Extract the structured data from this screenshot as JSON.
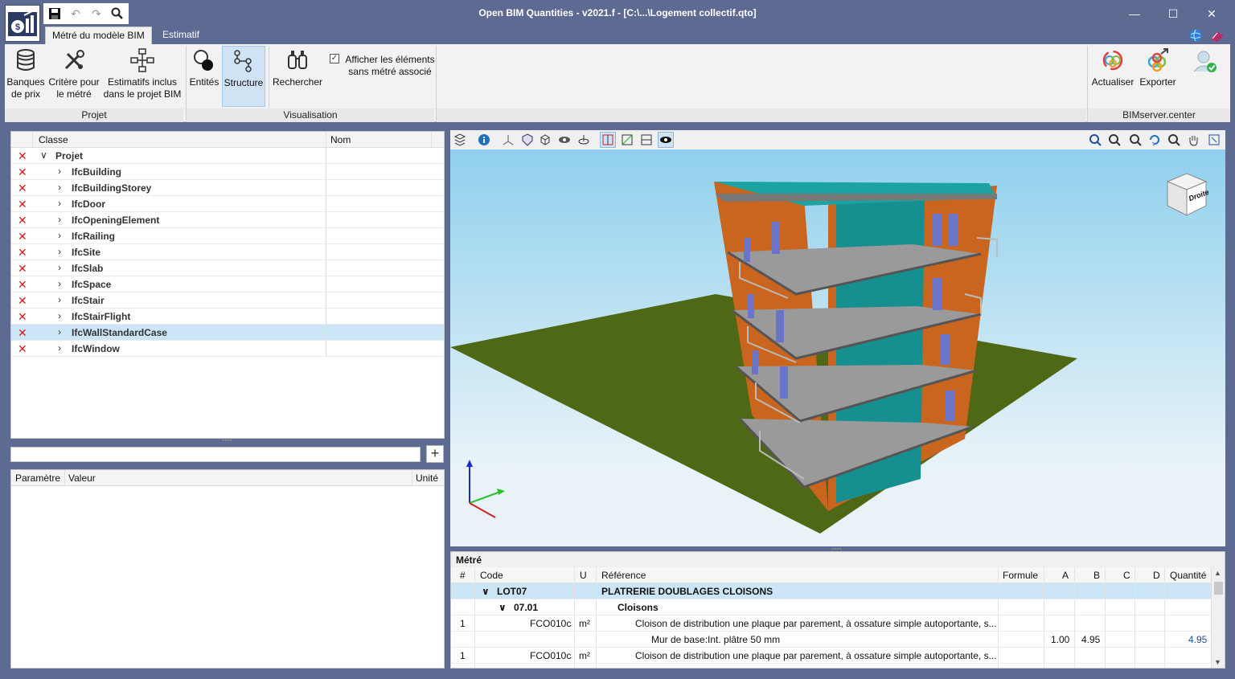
{
  "window": {
    "title": "Open BIM Quantities - v2021.f - [C:\\...\\Logement collectif.qto]",
    "minimize": "—",
    "maximize": "☐",
    "close": "✕"
  },
  "ribbon": {
    "tabs": [
      "Métré du modèle BIM",
      "Estimatif"
    ],
    "buttons": {
      "banques": "Banques de prix",
      "critere": "Critère pour le métré",
      "estimatifs": "Estimatifs inclus dans le projet BIM",
      "entites": "Entités",
      "structure": "Structure",
      "rechercher": "Rechercher",
      "actualiser": "Actualiser",
      "exporter": "Exporter"
    },
    "checkbox_label": "Afficher les éléments sans métré associé",
    "groups": {
      "projet": "Projet",
      "visualisation": "Visualisation",
      "bimserver": "BIMserver.center"
    }
  },
  "tree": {
    "columns": [
      "Classe",
      "Nom"
    ],
    "root": "Projet",
    "items": [
      "IfcBuilding",
      "IfcBuildingStorey",
      "IfcDoor",
      "IfcOpeningElement",
      "IfcRailing",
      "IfcSite",
      "IfcSlab",
      "IfcSpace",
      "IfcStair",
      "IfcStairFlight",
      "IfcWallStandardCase",
      "IfcWindow"
    ],
    "selected_item": "IfcWallStandardCase"
  },
  "params": {
    "columns": [
      "Paramètre",
      "Valeur",
      "Unité"
    ]
  },
  "viewer": {
    "view_cube_label": "Droite"
  },
  "metre": {
    "title": "Métré",
    "columns": [
      "#",
      "Code",
      "U",
      "Référence",
      "Formule",
      "A",
      "B",
      "C",
      "D",
      "Quantité"
    ],
    "rows": [
      {
        "num": "",
        "code": "LOT07",
        "unit": "",
        "ref": "PLATRERIE DOUBLAGES CLOISONS",
        "a": "",
        "b": "",
        "qty": ""
      },
      {
        "num": "",
        "code": "07.01",
        "unit": "",
        "ref": "Cloisons",
        "a": "",
        "b": "",
        "qty": ""
      },
      {
        "num": "1",
        "code": "FCO010c",
        "unit": "m²",
        "ref": "Cloison de distribution une plaque par parement, à ossature simple autoportante, s...",
        "a": "",
        "b": "",
        "qty": ""
      },
      {
        "num": "",
        "code": "",
        "unit": "",
        "ref": "Mur de base:Int. plâtre 50 mm",
        "a": "1.00",
        "b": "4.95",
        "qty": "4.95"
      },
      {
        "num": "1",
        "code": "FCO010c",
        "unit": "m²",
        "ref": "Cloison de distribution une plaque par parement, à ossature simple autoportante, s...",
        "a": "",
        "b": "",
        "qty": ""
      }
    ]
  }
}
